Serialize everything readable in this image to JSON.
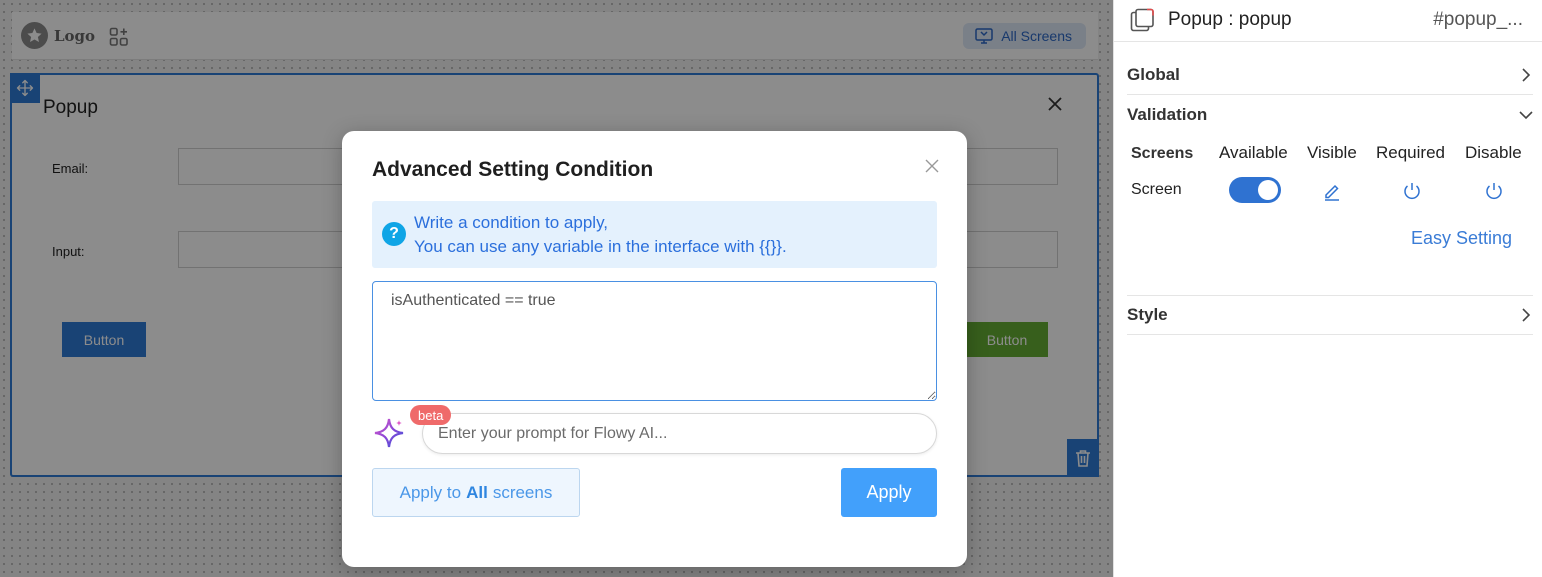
{
  "canvas": {
    "logo_text": "Logo",
    "all_screens_label": "All Screens",
    "popup": {
      "title": "Popup",
      "email_label": "Email:",
      "input_label": "Input:",
      "button_left": "Button",
      "button_right": "Button"
    }
  },
  "modal": {
    "title": "Advanced Setting Condition",
    "info_icon": "?",
    "info_line1": "Write a condition to apply,",
    "info_line2": "You can use any variable in the interface with {{}}.",
    "condition_value": "isAuthenticated == true",
    "beta_label": "beta",
    "ai_placeholder": "Enter your prompt for Flowy AI...",
    "apply_all_prefix": "Apply to",
    "apply_all_bold": "All",
    "apply_all_suffix": "screens",
    "apply_label": "Apply"
  },
  "panel": {
    "title": "Popup : popup",
    "id": "#popup_...",
    "sections": {
      "global": "Global",
      "validation": "Validation",
      "style": "Style"
    },
    "validation": {
      "columns": [
        "Screens",
        "Available",
        "Visible",
        "Required",
        "Disable"
      ],
      "row_label": "Screen",
      "available_on": true,
      "easy_setting": "Easy Setting"
    }
  },
  "colors": {
    "accent": "#2f7ad6",
    "apply": "#42a0fb",
    "beta": "#ef6a6a",
    "green_button": "#64ad33"
  }
}
